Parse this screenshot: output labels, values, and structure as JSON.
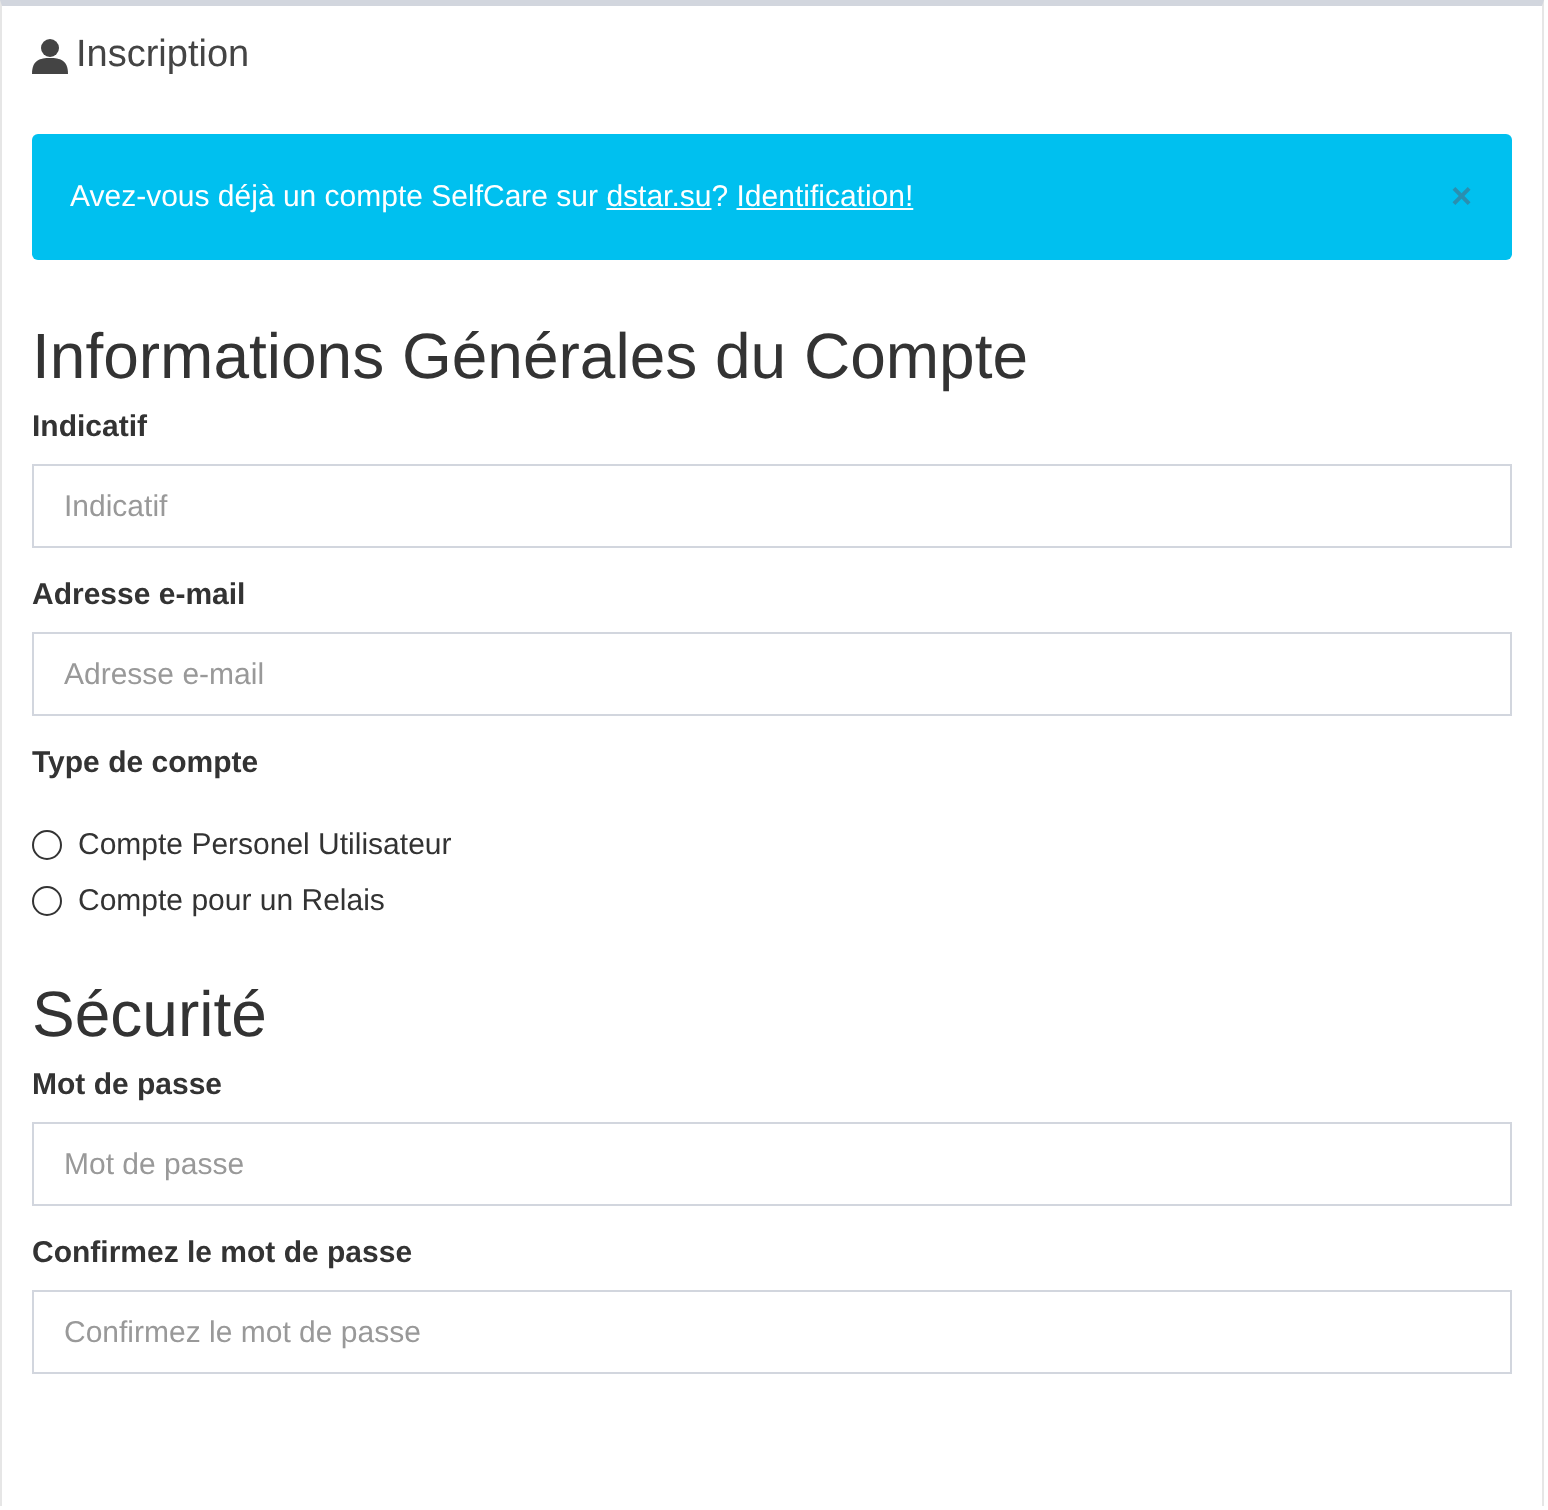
{
  "panel": {
    "title": "Inscription"
  },
  "alert": {
    "parts": [
      {
        "kind": "text",
        "text": "Avez-vous déjà un compte SelfCare sur"
      },
      {
        "kind": "link",
        "text": "dstar.su"
      },
      {
        "kind": "text",
        "text": "?"
      },
      {
        "kind": "link",
        "text": "Identification!"
      }
    ],
    "close": "×"
  },
  "sections": [
    {
      "heading": "Informations Générales du Compte",
      "fields": [
        {
          "kind": "text",
          "label": "Indicatif",
          "placeholder": "Indicatif"
        },
        {
          "kind": "text",
          "label": "Adresse e-mail",
          "placeholder": "Adresse e-mail"
        },
        {
          "kind": "radio",
          "label": "Type de compte",
          "options": [
            {
              "label": "Compte Personel Utilisateur",
              "selected": false
            },
            {
              "label": "Compte pour un Relais",
              "selected": false
            }
          ]
        }
      ]
    },
    {
      "heading": "Sécurité",
      "fields": [
        {
          "kind": "text",
          "label": "Mot de passe",
          "placeholder": "Mot de passe"
        },
        {
          "kind": "text",
          "label": "Confirmez le mot de passe",
          "placeholder": "Confirmez le mot de passe"
        }
      ]
    }
  ]
}
